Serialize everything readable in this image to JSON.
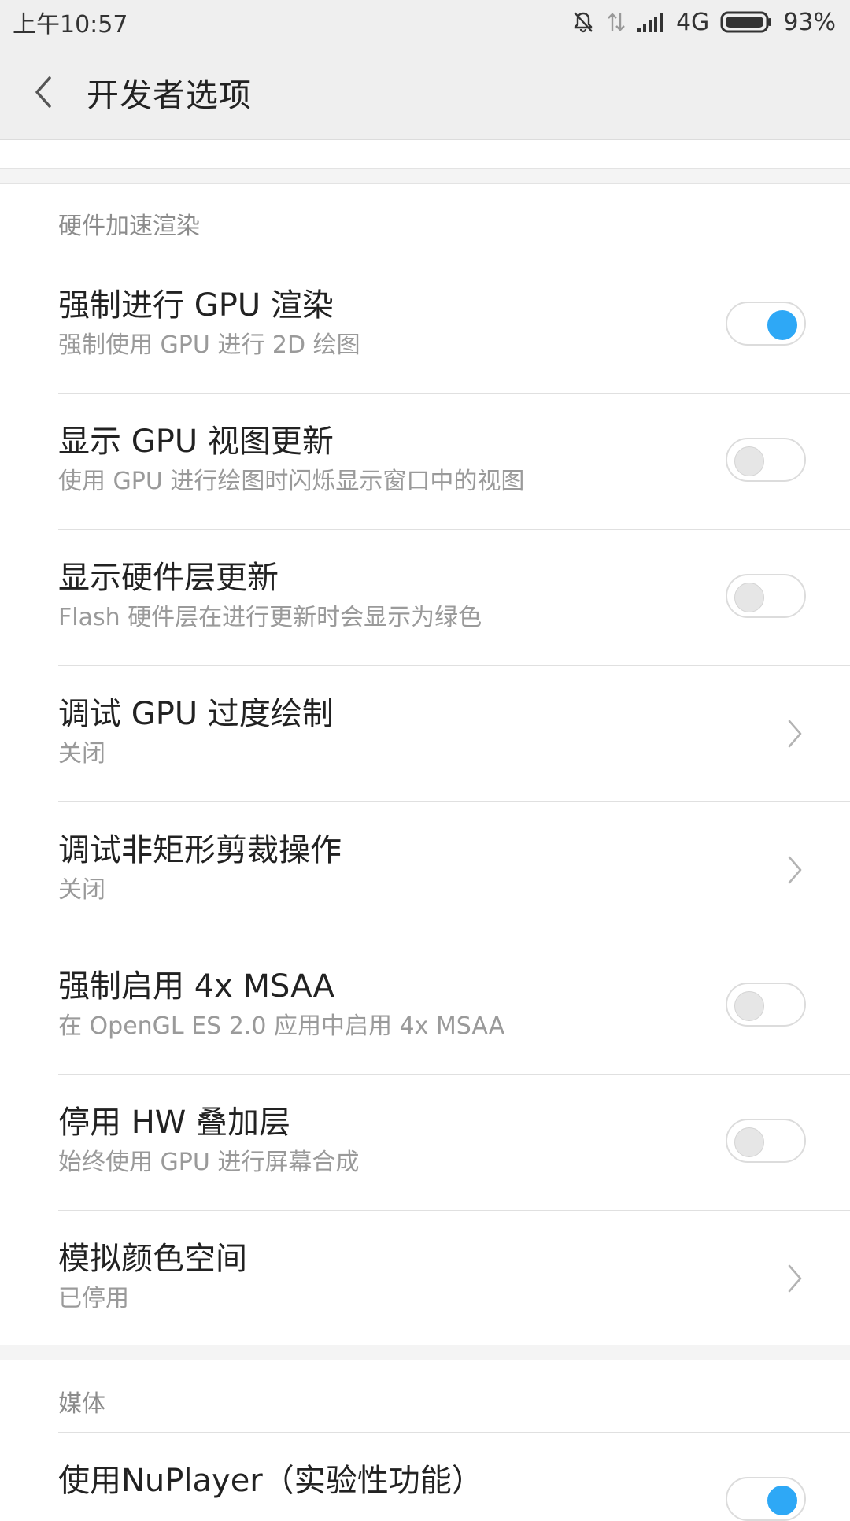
{
  "status": {
    "time": "上午10:57",
    "network": "4G",
    "battery": "93%",
    "icons": [
      "mute-icon",
      "data-arrows-icon",
      "signal-icon",
      "battery-icon"
    ]
  },
  "header": {
    "title": "开发者选项",
    "back_icon": "back-arrow-icon"
  },
  "sections": [
    {
      "header": "硬件加速渲染",
      "items": [
        {
          "title": "强制进行 GPU 渲染",
          "subtitle": "强制使用 GPU 进行 2D 绘图",
          "control": "toggle",
          "on": true
        },
        {
          "title": "显示 GPU 视图更新",
          "subtitle": "使用 GPU 进行绘图时闪烁显示窗口中的视图",
          "control": "toggle",
          "on": false
        },
        {
          "title": "显示硬件层更新",
          "subtitle": "Flash 硬件层在进行更新时会显示为绿色",
          "control": "toggle",
          "on": false
        },
        {
          "title": "调试 GPU 过度绘制",
          "subtitle": "关闭",
          "control": "chevron"
        },
        {
          "title": "调试非矩形剪裁操作",
          "subtitle": "关闭",
          "control": "chevron"
        },
        {
          "title": "强制启用 4x MSAA",
          "subtitle": "在 OpenGL ES 2.0 应用中启用 4x MSAA",
          "control": "toggle",
          "on": false
        },
        {
          "title": "停用 HW 叠加层",
          "subtitle": "始终使用 GPU 进行屏幕合成",
          "control": "toggle",
          "on": false
        },
        {
          "title": "模拟颜色空间",
          "subtitle": "已停用",
          "control": "chevron"
        }
      ]
    },
    {
      "header": "媒体",
      "items": [
        {
          "title": "使用NuPlayer（实验性功能）",
          "subtitle": "",
          "control": "toggle",
          "on": true
        }
      ]
    }
  ],
  "colors": {
    "accent": "#2ea8f6",
    "background": "#ffffff",
    "bar": "#efefef"
  }
}
